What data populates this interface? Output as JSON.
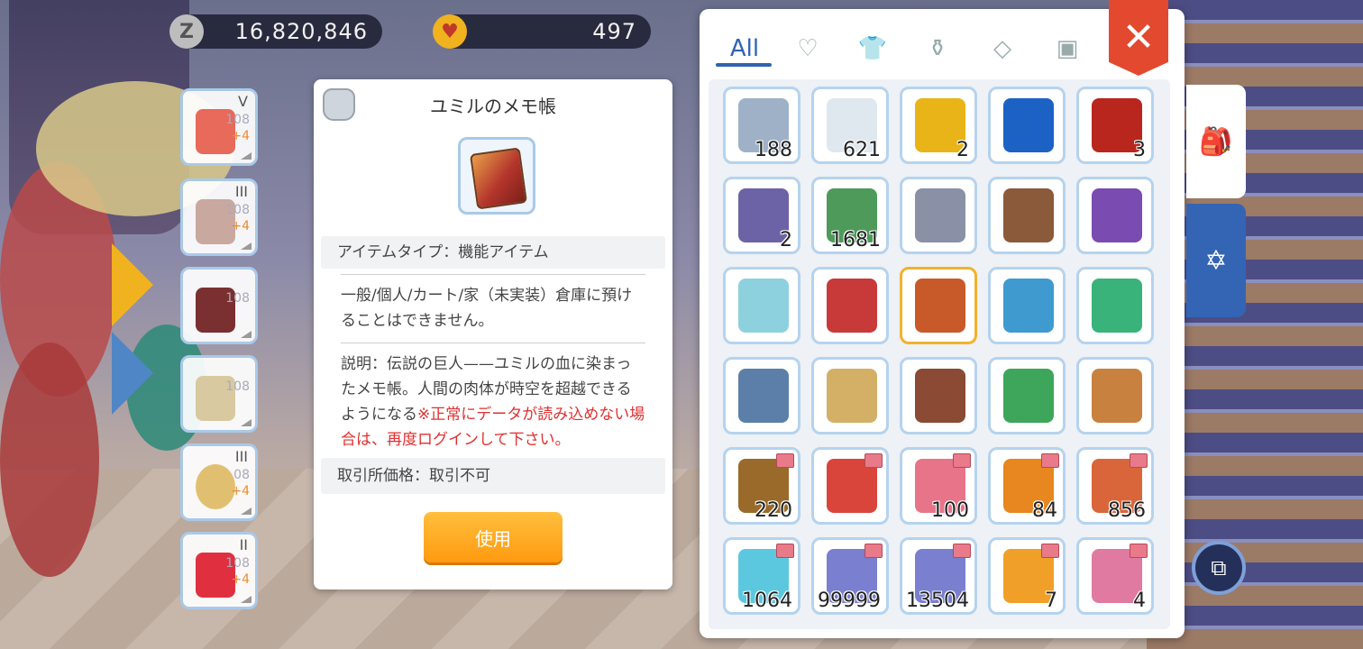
{
  "currency": {
    "zeny": {
      "icon": "Z",
      "value": "16,820,846"
    },
    "gems": {
      "value": "497"
    }
  },
  "equipment": [
    {
      "tier": "V",
      "level": "108",
      "refine": "+4"
    },
    {
      "tier": "III",
      "level": "108",
      "refine": "+4"
    },
    {
      "tier": "",
      "level": "108",
      "refine": ""
    },
    {
      "tier": "",
      "level": "108",
      "refine": ""
    },
    {
      "tier": "III",
      "level": "08",
      "refine": "+4"
    },
    {
      "tier": "II",
      "level": "108",
      "refine": "+4"
    }
  ],
  "detail": {
    "title": "ユミルのメモ帳",
    "item_type": "アイテムタイプ：機能アイテム",
    "storage_note": "一般/個人/カート/家（未実装）倉庫に預けることはできません。",
    "description": "説明：伝説の巨人——ユミルの血に染まったメモ帳。人間の肉体が時空を超越できるようになる",
    "warning": "※正常にデータが読み込めない場合は、再度ログインして下さい。",
    "trade_price": "取引所価格：取引不可",
    "use_label": "使用"
  },
  "inventory": {
    "tabs": [
      {
        "label": "All",
        "icon": "all-tab"
      },
      {
        "label": "",
        "icon": "heart-icon"
      },
      {
        "label": "",
        "icon": "shirt-icon"
      },
      {
        "label": "",
        "icon": "potion-icon"
      },
      {
        "label": "",
        "icon": "diamond-icon"
      },
      {
        "label": "",
        "icon": "card-icon"
      }
    ],
    "close_label": "✕",
    "items": [
      {
        "qty": "188",
        "color": "#9fb1c7",
        "shop": false
      },
      {
        "qty": "621",
        "color": "#dfe7ef",
        "shop": false
      },
      {
        "qty": "2",
        "color": "#e8b418",
        "shop": false
      },
      {
        "qty": "",
        "color": "#1c62c4",
        "shop": false
      },
      {
        "qty": "3",
        "color": "#b8261d",
        "shop": false
      },
      {
        "qty": "2",
        "color": "#6c63a6",
        "shop": false
      },
      {
        "qty": "1681",
        "color": "#4e9a5a",
        "shop": false
      },
      {
        "qty": "",
        "color": "#8a90a6",
        "shop": false
      },
      {
        "qty": "",
        "color": "#8b5a3a",
        "shop": false
      },
      {
        "qty": "",
        "color": "#7a4bb0",
        "shop": false
      },
      {
        "qty": "",
        "color": "#8ed1de",
        "shop": false
      },
      {
        "qty": "",
        "color": "#c83a3a",
        "shop": false
      },
      {
        "qty": "",
        "color": "#c85a2a",
        "shop": false
      },
      {
        "qty": "",
        "color": "#3f9ad0",
        "shop": false
      },
      {
        "qty": "",
        "color": "#39b37a",
        "shop": false
      },
      {
        "qty": "",
        "color": "#5b7fa8",
        "shop": false
      },
      {
        "qty": "",
        "color": "#d3b066",
        "shop": false
      },
      {
        "qty": "",
        "color": "#8a4a34",
        "shop": false
      },
      {
        "qty": "",
        "color": "#3ea65a",
        "shop": false
      },
      {
        "qty": "",
        "color": "#c8813f",
        "shop": false
      },
      {
        "qty": "220",
        "color": "#9a6a2a",
        "shop": true
      },
      {
        "qty": "",
        "color": "#d9453a",
        "shop": true
      },
      {
        "qty": "100",
        "color": "#e8748a",
        "shop": true
      },
      {
        "qty": "84",
        "color": "#e8861f",
        "shop": true
      },
      {
        "qty": "856",
        "color": "#d9663a",
        "shop": true
      },
      {
        "qty": "1064",
        "color": "#5cc8e0",
        "shop": true
      },
      {
        "qty": "99999",
        "color": "#7a7fd0",
        "shop": true
      },
      {
        "qty": "13504",
        "color": "#7a7fd0",
        "shop": true
      },
      {
        "qty": "7",
        "color": "#f0a028",
        "shop": true
      },
      {
        "qty": "4",
        "color": "#e07aa0",
        "shop": true
      }
    ],
    "selected_index": 12
  }
}
